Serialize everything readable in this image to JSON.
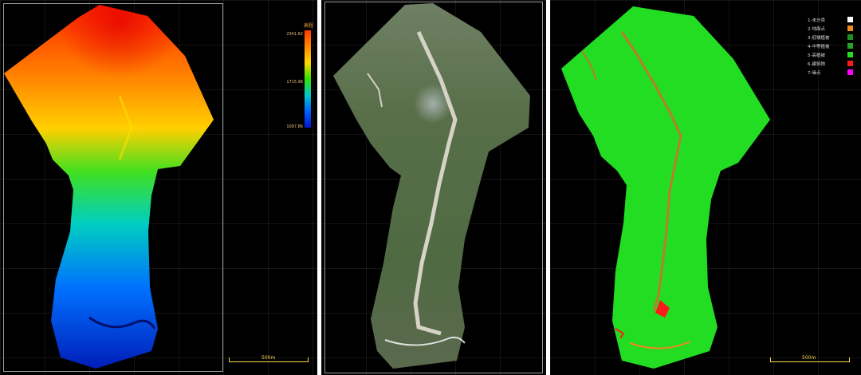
{
  "panels": {
    "elevation": {
      "legend": {
        "title": "高程",
        "max": "2341.62",
        "mid": "1715.98",
        "min": "1097.86",
        "colors": [
          "#ff3a00",
          "#ff8a00",
          "#ffd800",
          "#33e000",
          "#00c8c8",
          "#0060ff",
          "#0018d0"
        ]
      },
      "scale_label": "500m"
    },
    "rgb": {
      "colors": {
        "forest": "#5d7a4e",
        "riverbed": "#d4d1c4",
        "haze": "#9aa7a5"
      }
    },
    "classification": {
      "legend": [
        {
          "label": "1-未分类",
          "color": "#ffffff"
        },
        {
          "label": "2-地面点",
          "color": "#f08a1e"
        },
        {
          "label": "3-低矮植被",
          "color": "#1f8f24"
        },
        {
          "label": "4-中等植被",
          "color": "#25a428"
        },
        {
          "label": "5-高植被",
          "color": "#22dd22"
        },
        {
          "label": "6-建筑物",
          "color": "#ff1a1a"
        },
        {
          "label": "7-噪点",
          "color": "#ff00ff"
        }
      ],
      "scale_label": "500m"
    }
  }
}
